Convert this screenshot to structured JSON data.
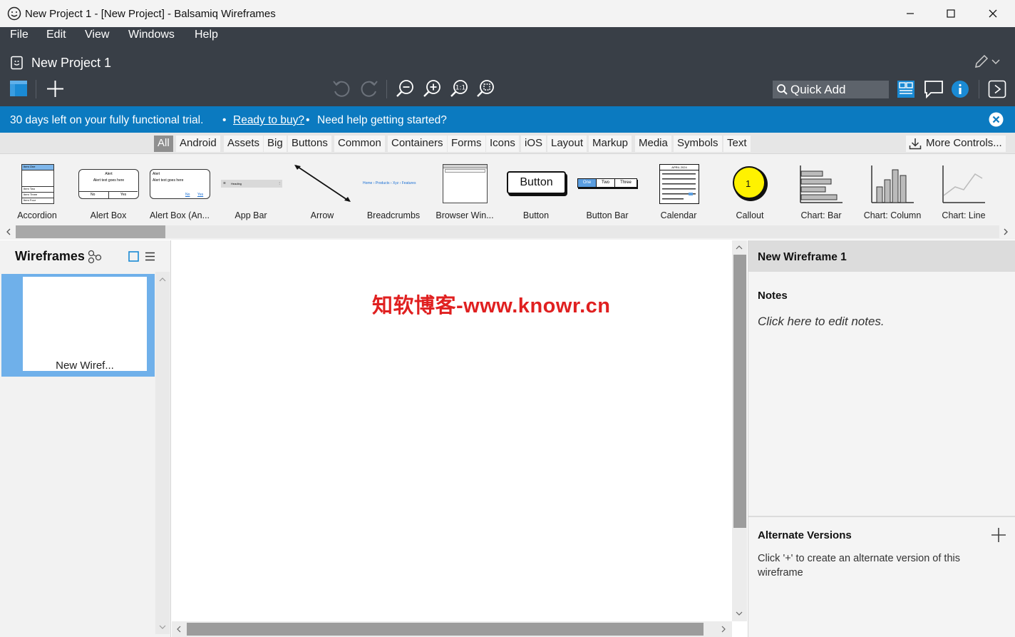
{
  "window": {
    "title": "New Project 1 - [New Project] - Balsamiq Wireframes"
  },
  "menu": [
    "File",
    "Edit",
    "View",
    "Windows",
    "Help"
  ],
  "project": {
    "title": "New Project 1"
  },
  "toolbar": {
    "quick_add_placeholder": "Quick Add"
  },
  "trial": {
    "message": "30 days left on your fully functional trial.",
    "separator": "•",
    "buy_link": "Ready to buy?",
    "help_text": "Need help getting started?"
  },
  "categories": [
    "All",
    "Android",
    "Assets",
    "Big",
    "Buttons",
    "Common",
    "Containers",
    "Forms",
    "Icons",
    "iOS",
    "Layout",
    "Markup",
    "Media",
    "Symbols",
    "Text"
  ],
  "more_controls": "More Controls...",
  "components": [
    "Accordion",
    "Alert Box",
    "Alert Box (An...",
    "App Bar",
    "Arrow",
    "Breadcrumbs",
    "Browser Win...",
    "Button",
    "Button Bar",
    "Calendar",
    "Callout",
    "Chart: Bar",
    "Chart: Column",
    "Chart: Line"
  ],
  "previews": {
    "accordion_items": [
      "Item One",
      "Item Two",
      "Item Three",
      "Item Four"
    ],
    "alert_title": "Alert",
    "alert_text": "Alert text goes here",
    "alert_no": "No",
    "alert_yes": "Yes",
    "appbar_heading": "Heading",
    "breadcrumbs": "Home › Products › Xyz › Features",
    "button_label": "Button",
    "buttonbar": [
      "One",
      "Two",
      "Three"
    ],
    "calendar_month": "APRIL 2024",
    "callout_number": "1"
  },
  "wireframes": {
    "panel_title": "Wireframes",
    "items": [
      {
        "label": "New Wiref..."
      }
    ]
  },
  "canvas": {
    "watermark": "知软博客-www.knowr.cn"
  },
  "properties": {
    "wireframe_name": "New Wireframe 1",
    "notes_label": "Notes",
    "notes_placeholder": "Click here to edit notes.",
    "alt_title": "Alternate Versions",
    "alt_desc": "Click '+' to create an alternate version of this wireframe"
  },
  "colors": {
    "header_bg": "#393f47",
    "trial_bg": "#0b7ac0",
    "accent": "#1a8ad4",
    "selection": "#6fb0ea"
  }
}
